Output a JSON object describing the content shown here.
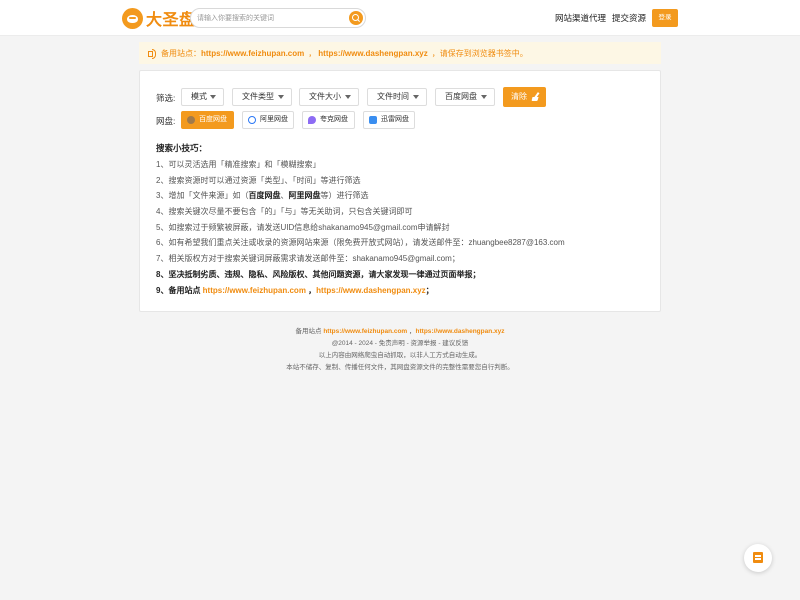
{
  "header": {
    "logo_text": "大圣盘",
    "search_placeholder": "请输入你要搜索的关键词",
    "nav": [
      "网站渠道代理",
      "提交资源"
    ],
    "login_label": "登录"
  },
  "notice": {
    "prefix": "备用站点：",
    "site1": "https://www.feizhupan.com",
    "sep": "，",
    "site2": "https://www.dashengpan.xyz",
    "suffix": "，请保存到浏览器书签中。"
  },
  "filters": {
    "label": "筛选:",
    "dropdowns": [
      "模式",
      "文件类型",
      "文件大小",
      "文件时间",
      "百度网盘"
    ],
    "clear_label": "清除"
  },
  "pans": {
    "label": "网盘:",
    "items": [
      "百度网盘",
      "阿里网盘",
      "夸克网盘",
      "迅雷网盘"
    ]
  },
  "tips": {
    "title": "搜索小技巧：",
    "t1": "1、可以灵活选用「精准搜索」和「模糊搜索」",
    "t2": "2、搜索资源时可以通过资源「类型」、「时间」等进行筛选",
    "t3_a": "3、增加「文件来源」如（",
    "t3_b1": "百度网盘",
    "t3_sep": "、",
    "t3_b2": "阿里网盘",
    "t3_c": "等）进行筛选",
    "t4": "4、搜索关键次尽量不要包含「的」「与」等无关助词，只包含关键词即可",
    "t5": "5、如搜索过于频繁被屏蔽，请发送UID信息给shakanamo945@gmail.com申请解封",
    "t6": "6、如有希望我们重点关注或收录的资源网站来源（限免费开放式网站），请发送邮件至：zhuangbee8287@163.com",
    "t7": "7、相关版权方对于搜索关键词屏蔽需求请发送邮件至：shakanamo945@gmail.com；",
    "t8": "8、坚决抵制劣质、违规、隐私、风险版权、其他问题资源，请大家发现一律通过页面举报；",
    "t9_a": "9、备用站点 ",
    "t9_site1": "https://www.feizhupan.com",
    "t9_sep": " ，",
    "t9_site2": "https://www.dashengpan.xyz",
    "t9_end": "；"
  },
  "footer": {
    "backup_prefix": "备用站点 ",
    "site1": "https://www.feizhupan.com",
    "sep": " ，",
    "site2": "https://www.dashengpan.xyz",
    "line2": "@2014 - 2024 - 免责声明 - 资源举报 - 建议反馈",
    "line3": "以上内容由网络爬虫自动抓取，以非人工方式自动生成。",
    "line4": "本站不储存、复制、传播任何文件，其网盘资源文件的完整性需要您自行判断。"
  },
  "colors": {
    "accent": "#f39a1e",
    "link": "#f08c10",
    "notice_bg": "#fdf7e5"
  },
  "icons": {
    "logo": "monkey-logo-icon",
    "search": "search-icon",
    "notice": "speaker-icon",
    "clear": "broom-icon",
    "float": "bookmark-icon"
  }
}
